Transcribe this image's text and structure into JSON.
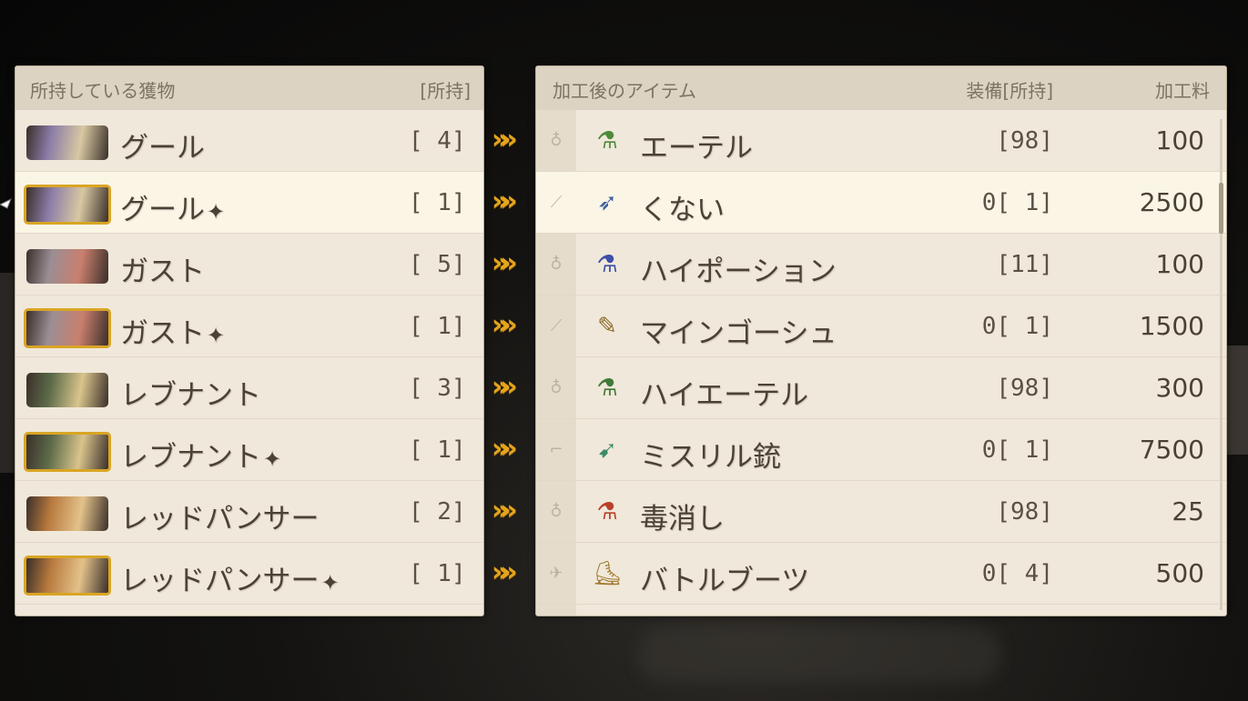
{
  "left_panel": {
    "header_title": "所持している獲物",
    "header_owned": "[所持]",
    "rows": [
      {
        "name": "グール",
        "plus": "",
        "count": "[ 4]",
        "portrait": "ghoul-portrait",
        "colors": [
          "#8c7da8",
          "#d8c8a2"
        ]
      },
      {
        "name": "グール",
        "plus": "✦",
        "count": "[ 1]",
        "portrait": "ghoul-plus-portrait",
        "colors": [
          "#8c7da8",
          "#d8c8a2"
        ]
      },
      {
        "name": "ガスト",
        "plus": "",
        "count": "[ 5]",
        "portrait": "ghast-portrait",
        "colors": [
          "#9a8e94",
          "#c97f6d"
        ]
      },
      {
        "name": "ガスト",
        "plus": "✦",
        "count": "[ 1]",
        "portrait": "ghast-plus-portrait",
        "colors": [
          "#9a8e94",
          "#c97f6d"
        ]
      },
      {
        "name": "レブナント",
        "plus": "",
        "count": "[ 3]",
        "portrait": "revenant-portrait",
        "colors": [
          "#5d6b49",
          "#d9c48c"
        ]
      },
      {
        "name": "レブナント",
        "plus": "✦",
        "count": "[ 1]",
        "portrait": "revenant-plus-portrait",
        "colors": [
          "#5d6b49",
          "#d9c48c"
        ]
      },
      {
        "name": "レッドパンサー",
        "plus": "",
        "count": "[ 2]",
        "portrait": "red-panther-portrait",
        "colors": [
          "#b87a3e",
          "#e3c28a"
        ]
      },
      {
        "name": "レッドパンサー",
        "plus": "✦",
        "count": "[ 1]",
        "portrait": "red-panther-plus-portrait",
        "colors": [
          "#b87a3e",
          "#e3c28a"
        ]
      }
    ]
  },
  "right_panel": {
    "header_title": "加工後のアイテム",
    "header_equip": "装備[所持]",
    "header_fee": "加工料",
    "rows": [
      {
        "type_icon": "flask-type-icon",
        "type_glyph": "♁",
        "item_icon": "ether-icon",
        "item_glyph": "⚗",
        "item_color": "#4f8a3c",
        "name": "エーテル",
        "equip": " [98]",
        "fee": "100"
      },
      {
        "type_icon": "dagger-type-icon",
        "type_glyph": "⟋",
        "item_icon": "kunai-icon",
        "item_glyph": "➶",
        "item_color": "#3b5f9c",
        "name": "くない",
        "equip": "0[ 1]",
        "fee": "2500"
      },
      {
        "type_icon": "flask-type-icon",
        "type_glyph": "♁",
        "item_icon": "hi-potion-icon",
        "item_glyph": "⚗",
        "item_color": "#3d4fa8",
        "name": "ハイポーション",
        "equip": " [11]",
        "fee": "100"
      },
      {
        "type_icon": "dagger-type-icon",
        "type_glyph": "⟋",
        "item_icon": "main-gauche-icon",
        "item_glyph": "✎",
        "item_color": "#8a6a2a",
        "name": "マインゴーシュ",
        "equip": "0[ 1]",
        "fee": "1500"
      },
      {
        "type_icon": "flask-type-icon",
        "type_glyph": "♁",
        "item_icon": "hi-ether-icon",
        "item_glyph": "⚗",
        "item_color": "#3f7a3a",
        "name": "ハイエーテル",
        "equip": " [98]",
        "fee": "300"
      },
      {
        "type_icon": "gun-type-icon",
        "type_glyph": "⌐",
        "item_icon": "mythril-gun-icon",
        "item_glyph": "➹",
        "item_color": "#3c8a6a",
        "name": "ミスリル銃",
        "equip": "0[ 1]",
        "fee": "7500"
      },
      {
        "type_icon": "flask-type-icon",
        "type_glyph": "♁",
        "item_icon": "antidote-icon",
        "item_glyph": "⚗",
        "item_color": "#b8412c",
        "name": "毒消し",
        "equip": " [98]",
        "fee": "25"
      },
      {
        "type_icon": "boots-type-icon",
        "type_glyph": "✈",
        "item_icon": "battle-boots-icon",
        "item_glyph": "⛸",
        "item_color": "#a0782e",
        "name": "バトルブーツ",
        "equip": "0[ 4]",
        "fee": "500"
      }
    ]
  },
  "selected_row": 1,
  "arrow_glyph": "»»",
  "colors": {
    "accent_gold": "#e5a51c",
    "panel_bg": "#f0e8da",
    "header_bg": "#ddd3c3",
    "text": "#4b4136"
  }
}
